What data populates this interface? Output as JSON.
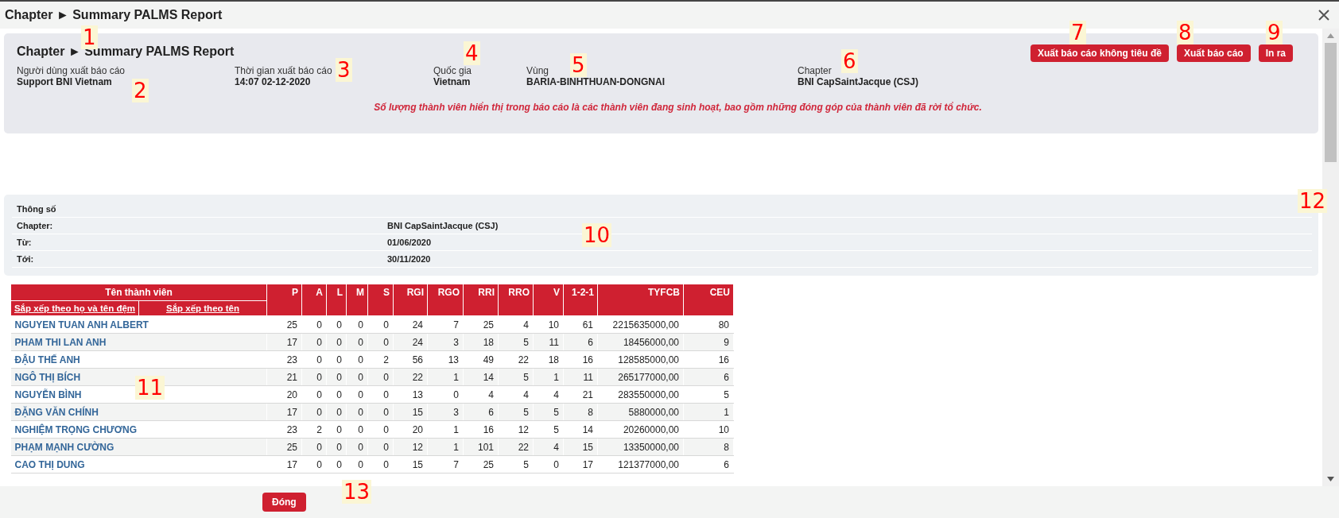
{
  "window": {
    "title": "Chapter ► Summary PALMS Report"
  },
  "report_header": {
    "title": "Chapter ► Summary PALMS Report",
    "fields": [
      {
        "label": "Người dùng xuất báo cáo",
        "value": "Support BNI Vietnam"
      },
      {
        "label": "Thời gian xuất báo cáo",
        "value": "14:07 02-12-2020"
      },
      {
        "label": "Quốc gia",
        "value": "Vietnam"
      },
      {
        "label": "Vùng",
        "value": "BARIA-BINHTHUAN-DONGNAI"
      },
      {
        "label": "Chapter",
        "value": "BNI CapSaintJacque (CSJ)"
      }
    ],
    "buttons": [
      "Xuất báo cáo không tiêu đề",
      "Xuất báo cáo",
      "In ra"
    ],
    "note": "Số lượng thành viên hiển thị trong báo cáo là các thành viên đang sinh hoạt, bao gồm những đóng góp của thành viên đã rời tổ chức."
  },
  "parameters": {
    "title": "Thông số",
    "rows": [
      {
        "label": "Chapter:",
        "value": "BNI CapSaintJacque (CSJ)"
      },
      {
        "label": "Từ:",
        "value": "01/06/2020"
      },
      {
        "label": "Tới:",
        "value": "30/11/2020"
      }
    ]
  },
  "table": {
    "name_header": "Tên thành viên",
    "sort_links": [
      "Sắp xếp theo họ và tên đệm",
      "Sắp xếp theo tên"
    ],
    "columns": [
      "P",
      "A",
      "L",
      "M",
      "S",
      "RGI",
      "RGO",
      "RRI",
      "RRO",
      "V",
      "1-2-1",
      "TYFCB",
      "CEU"
    ],
    "rows": [
      {
        "name": "NGUYEN TUAN ANH ALBERT",
        "cells": [
          "25",
          "0",
          "0",
          "0",
          "0",
          "24",
          "7",
          "25",
          "4",
          "10",
          "61",
          "2215635000,00",
          "80"
        ]
      },
      {
        "name": "PHAM THI LAN ANH",
        "cells": [
          "17",
          "0",
          "0",
          "0",
          "0",
          "24",
          "3",
          "18",
          "5",
          "11",
          "6",
          "18456000,00",
          "9"
        ]
      },
      {
        "name": "ĐẬU THẾ ANH",
        "cells": [
          "23",
          "0",
          "0",
          "0",
          "2",
          "56",
          "13",
          "49",
          "22",
          "18",
          "16",
          "128585000,00",
          "16"
        ]
      },
      {
        "name": "NGÔ THỊ BÍCH",
        "cells": [
          "21",
          "0",
          "0",
          "0",
          "0",
          "22",
          "1",
          "14",
          "5",
          "1",
          "11",
          "265177000,00",
          "6"
        ]
      },
      {
        "name": "NGUYỄN BÌNH",
        "cells": [
          "20",
          "0",
          "0",
          "0",
          "0",
          "13",
          "0",
          "4",
          "4",
          "4",
          "21",
          "283550000,00",
          "5"
        ]
      },
      {
        "name": "ĐẶNG VĂN CHÍNH",
        "cells": [
          "17",
          "0",
          "0",
          "0",
          "0",
          "15",
          "3",
          "6",
          "5",
          "5",
          "8",
          "5880000,00",
          "1"
        ]
      },
      {
        "name": "NGHIỆM TRỌNG CHƯƠNG",
        "cells": [
          "23",
          "2",
          "0",
          "0",
          "0",
          "20",
          "1",
          "16",
          "12",
          "5",
          "14",
          "20260000,00",
          "10"
        ]
      },
      {
        "name": "PHẠM MẠNH CƯỜNG",
        "cells": [
          "25",
          "0",
          "0",
          "0",
          "0",
          "12",
          "1",
          "101",
          "22",
          "4",
          "15",
          "13350000,00",
          "8"
        ]
      },
      {
        "name": "CAO THỊ DUNG",
        "cells": [
          "17",
          "0",
          "0",
          "0",
          "0",
          "15",
          "7",
          "25",
          "5",
          "0",
          "17",
          "121377000,00",
          "6"
        ]
      }
    ]
  },
  "footer": {
    "close_button": "Đóng"
  },
  "callouts": [
    "1",
    "2",
    "3",
    "4",
    "5",
    "6",
    "7",
    "8",
    "9",
    "10",
    "11",
    "12",
    "13"
  ]
}
